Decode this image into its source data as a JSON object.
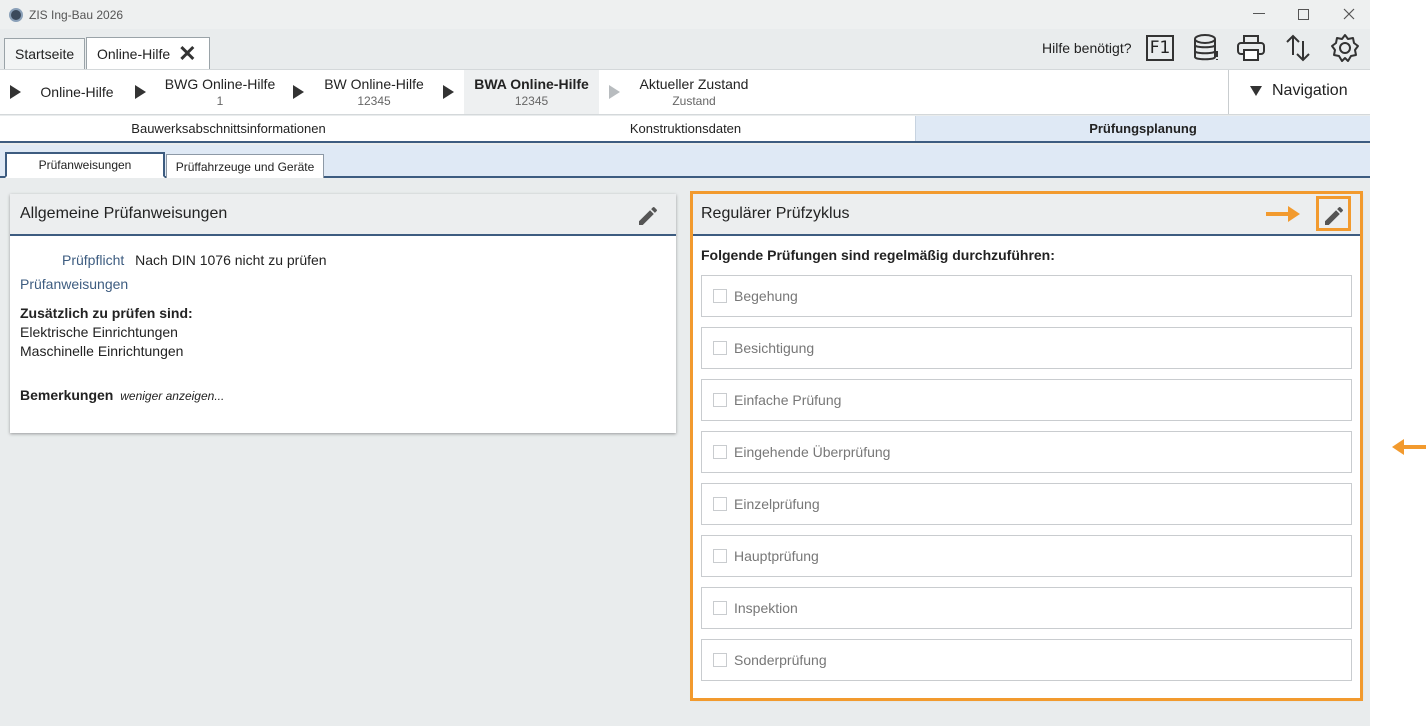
{
  "window": {
    "title": "ZIS Ing-Bau 2026"
  },
  "tabs": [
    {
      "label": "Startseite"
    },
    {
      "label": "Online-Hilfe",
      "close": "✕"
    }
  ],
  "toolbar": {
    "help_text": "Hilfe benötigt?",
    "f1_label": "F1",
    "icons": [
      "database-icon",
      "print-icon",
      "upload-icon",
      "settings-icon"
    ]
  },
  "breadcrumb": {
    "items": [
      {
        "title": "Online-Hilfe",
        "sub": ""
      },
      {
        "title": "BWG Online-Hilfe",
        "sub": "1"
      },
      {
        "title": "BW Online-Hilfe",
        "sub": "12345"
      },
      {
        "title": "BWA Online-Hilfe",
        "sub": "12345"
      },
      {
        "title": "Aktueller Zustand",
        "sub": "Zustand"
      }
    ],
    "navigation": "Navigation"
  },
  "section_tabs": [
    {
      "label": "Bauwerksabschnittsinformationen"
    },
    {
      "label": "Konstruktionsdaten"
    },
    {
      "label": "Prüfungsplanung"
    }
  ],
  "sub_tabs": [
    {
      "label": "Prüfanweisungen"
    },
    {
      "label": "Prüffahrzeuge und Geräte"
    }
  ],
  "left_panel": {
    "title": "Allgemeine Prüfanweisungen",
    "pruefpflicht_label": "Prüfpflicht",
    "pruefpflicht_value": "Nach DIN 1076 nicht zu prüfen",
    "pruefanweisungen_label": "Prüfanweisungen",
    "zusaetzlich_label": "Zusätzlich zu prüfen sind:",
    "zusaetzlich_items": [
      "Elektrische Einrichtungen",
      "Maschinelle Einrichtungen"
    ],
    "bemerkungen_label": "Bemerkungen",
    "show_less": "weniger anzeigen..."
  },
  "right_panel": {
    "title": "Regulärer Prüfzyklus",
    "intro": "Folgende Prüfungen sind regelmäßig durchzuführen:",
    "checks": [
      {
        "label": "Begehung",
        "checked": false
      },
      {
        "label": "Besichtigung",
        "checked": false
      },
      {
        "label": "Einfache Prüfung",
        "checked": false
      },
      {
        "label": "Eingehende Überprüfung",
        "checked": false
      },
      {
        "label": "Einzelprüfung",
        "checked": false
      },
      {
        "label": "Hauptprüfung",
        "checked": false
      },
      {
        "label": "Inspektion",
        "checked": false
      },
      {
        "label": "Sonderprüfung",
        "checked": false
      }
    ]
  },
  "colors": {
    "accent_orange": "#f29a2e",
    "header_blue": "#3d5c80",
    "active_tab_bg": "#dfe9f5"
  }
}
